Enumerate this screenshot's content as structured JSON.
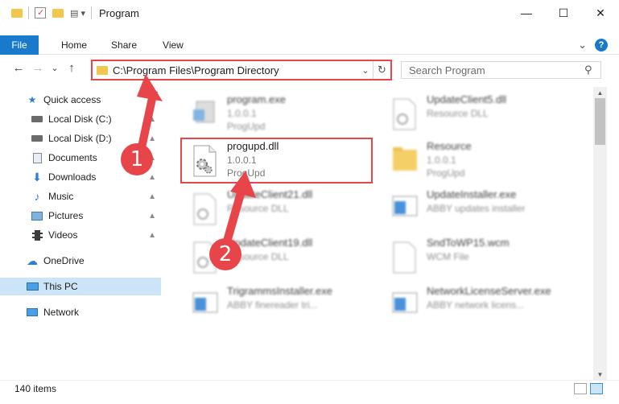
{
  "window": {
    "title": "Program",
    "minimize": "—",
    "maximize": "☐",
    "close": "✕"
  },
  "ribbon": {
    "file": "File",
    "tabs": [
      "Home",
      "Share",
      "View"
    ],
    "collapse": "⌄",
    "help": "?"
  },
  "nav": {
    "back": "←",
    "forward": "→",
    "recent": "⌄",
    "up": "↑"
  },
  "address": {
    "path": "C:\\Program Files\\Program Directory",
    "drop": "⌄",
    "refresh": "↻"
  },
  "search": {
    "placeholder": "Search Program",
    "icon": "⚲"
  },
  "sidebar": {
    "items": [
      {
        "label": "Quick access"
      },
      {
        "label": "Local Disk (C:)"
      },
      {
        "label": "Local Disk (D:)"
      },
      {
        "label": "Documents"
      },
      {
        "label": "Downloads"
      },
      {
        "label": "Music"
      },
      {
        "label": "Pictures"
      },
      {
        "label": "Videos"
      },
      {
        "label": "OneDrive"
      },
      {
        "label": "This PC"
      },
      {
        "label": "Network"
      }
    ],
    "pin": "📌"
  },
  "files": [
    {
      "name": "program.exe",
      "line2": "1.0.0.1",
      "line3": "ProgUpd"
    },
    {
      "name": "UpdateClient5.dll",
      "line2": "Resource DLL",
      "line3": ""
    },
    {
      "name": "progupd.dll",
      "line2": "1.0.0.1",
      "line3": "ProgUpd"
    },
    {
      "name": "Resource",
      "line2": "1.0.0.1",
      "line3": "ProgUpd"
    },
    {
      "name": "UpdateClient21.dll",
      "line2": "Resource DLL",
      "line3": ""
    },
    {
      "name": "UpdateInstaller.exe",
      "line2": "ABBY updates installer",
      "line3": ""
    },
    {
      "name": "UpdateClient19.dll",
      "line2": "Resource DLL",
      "line3": ""
    },
    {
      "name": "SndToWP15.wcm",
      "line2": "WCM File",
      "line3": ""
    },
    {
      "name": "TrigrammsInstaller.exe",
      "line2": "ABBY finereader tri...",
      "line3": ""
    },
    {
      "name": "NetworkLicenseServer.exe",
      "line2": "ABBY network licens...",
      "line3": ""
    }
  ],
  "status": {
    "count": "140 items"
  },
  "annotations": {
    "step1": "1",
    "step2": "2"
  },
  "colors": {
    "accent": "#1979ca",
    "highlight": "#e8454b",
    "selected": "#cce4f7"
  }
}
